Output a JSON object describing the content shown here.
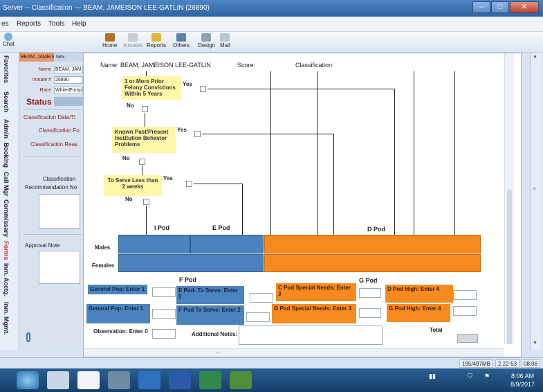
{
  "window": {
    "title": "Server -- Classification --- BEAM, JAMEISON LEE-GATLIN (26890)"
  },
  "menu": [
    "es",
    "Reports",
    "Tools",
    "Help"
  ],
  "toolbar": {
    "chat": "Chat",
    "items": [
      "Home",
      "Inmates",
      "Reports",
      "Others",
      "Design",
      "Mail"
    ]
  },
  "left_tabs": [
    "Favorites",
    "Search",
    "Admin",
    "Booking",
    "Call Mgr",
    "Commissary",
    "Forms",
    "Inm. Acctg.",
    "Inm. Mgmt."
  ],
  "left_panel": {
    "tab_label": "BEAM, JAMEISO...",
    "tab2_label": "Nex",
    "fields": [
      {
        "label": "Name",
        "value": "BEAM, JAM"
      },
      {
        "label": "Inmate #",
        "value": "26890"
      },
      {
        "label": "Race",
        "value": "White/Europ"
      }
    ],
    "status": "Status",
    "classification_date": "Classification Date/Ti",
    "classification_for": "Classification Fo",
    "classification_reason": "Classification Reas",
    "classification": "Classification",
    "recommendation": "Recommendation No",
    "approval": "Approval Note"
  },
  "dialog": {
    "name_label": "Name:",
    "name_value": "BEAM, JAMEISON LEE-GATLIN",
    "score_label": "Score:",
    "classification_label": "Classification:",
    "q1": "3 or More Prior Felony Convictions Within 5 Years",
    "q2": "Known Past/Present Institution Behavior Problems",
    "q3": "To Serve Less than 2 weeks",
    "yes": "Yes",
    "no": "No",
    "i_pod": "I Pod",
    "e_pod": "E Pod",
    "d_pod": "D Pod",
    "f_pod": "F Pod",
    "g_pod": "G Pod",
    "males": "Males",
    "females": "Females",
    "general_pop_1": "General Pop: Enter 1",
    "general_pop_1b": "General Pop: Enter 1",
    "e_pod_serve": "E Pod- To Serve: Enter 2",
    "f_pod_serve": "F Pod To Serve: Enter 2",
    "c_pod_special": "C Pod Special Needs: Enter 3",
    "g_pod_special": "G Pod Special Needs: Enter 3",
    "d_pod_high": "D Pod High: Enter 4",
    "g_pod_high": "G Pod High: Enter 4",
    "observation": "Observation: Enter 0",
    "additional_notes": "Additional Notes:",
    "total": "Total"
  },
  "statusbar": {
    "memory": "195/497MB",
    "code": "2.22-53",
    "time": "08:06"
  },
  "clock": {
    "time": "8:06 AM",
    "date": "8/9/2017"
  },
  "colors": {
    "blue": "#4a83bd",
    "orange": "#f78a1f",
    "yellow": "#fff7a8"
  }
}
